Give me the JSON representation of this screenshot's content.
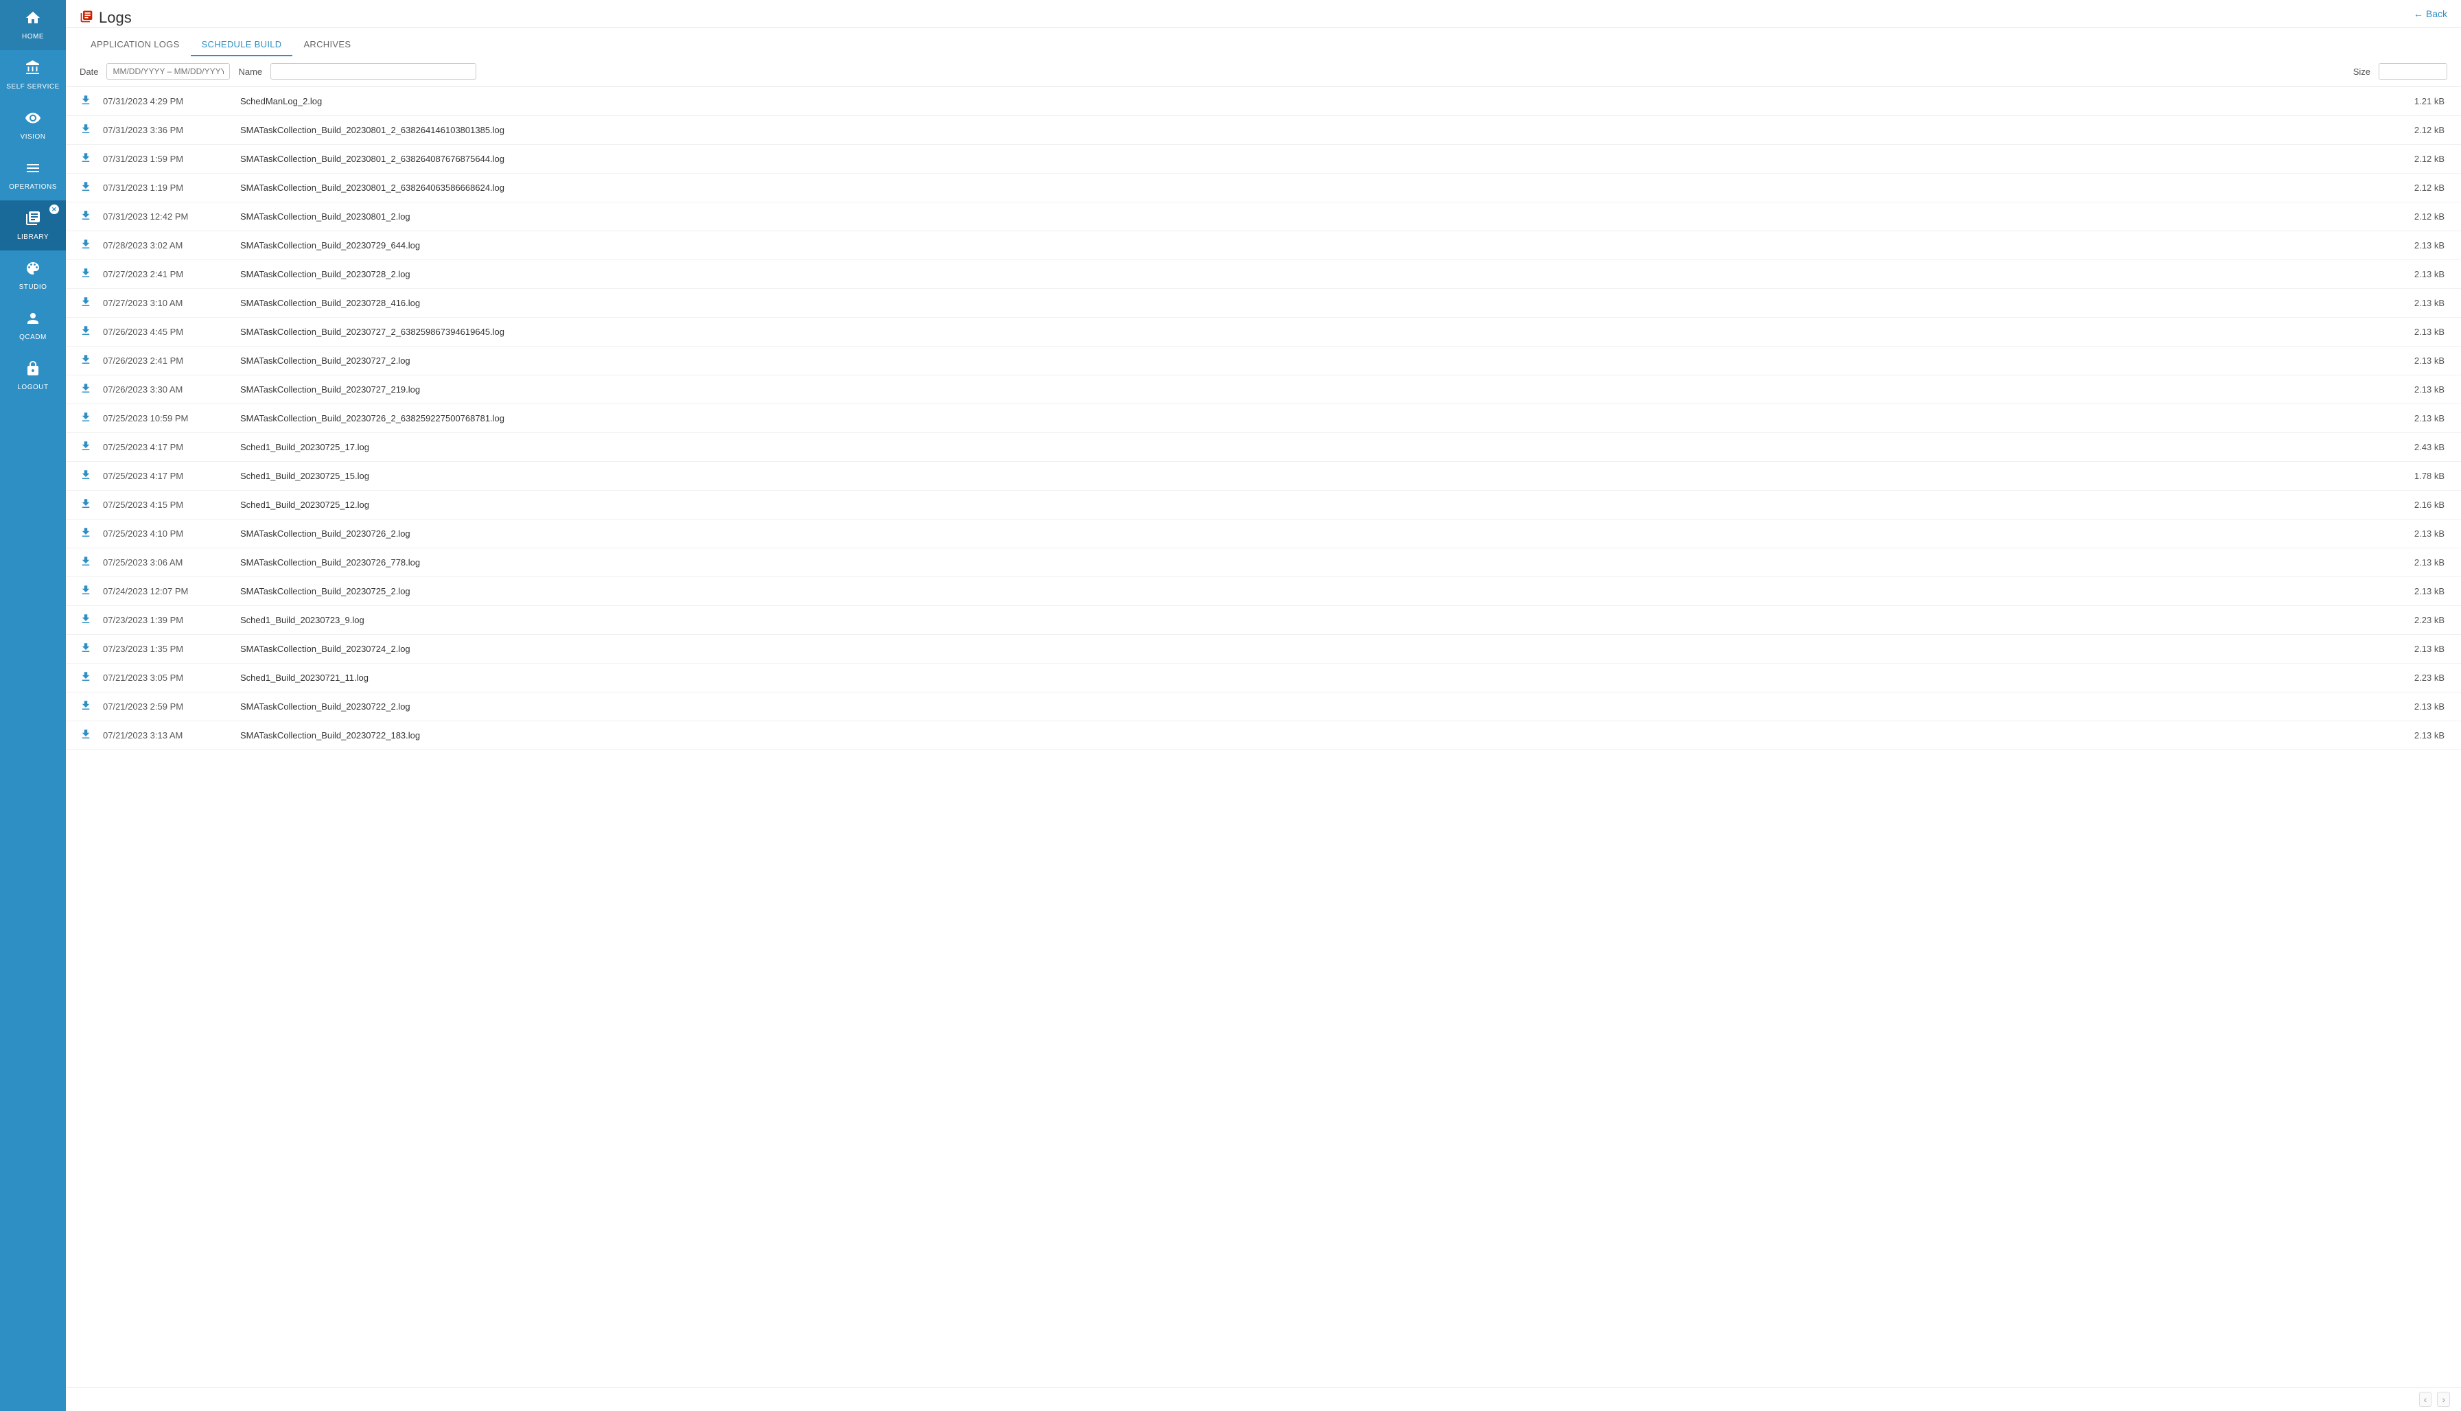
{
  "app": {
    "title": "Logs",
    "back_label": "Back"
  },
  "sidebar": {
    "items": [
      {
        "id": "home",
        "label": "HOME",
        "icon": "⌂",
        "active": false
      },
      {
        "id": "self-service",
        "label": "SELF SERVICE",
        "icon": "⇄",
        "active": false
      },
      {
        "id": "vision",
        "label": "VISION",
        "icon": "👁",
        "active": false
      },
      {
        "id": "operations",
        "label": "OPERATIONS",
        "icon": "≡",
        "active": false
      },
      {
        "id": "library",
        "label": "LIBRARY",
        "icon": "📚",
        "active": true
      },
      {
        "id": "studio",
        "label": "STUDIO",
        "icon": "🎨",
        "active": false
      },
      {
        "id": "qcadm",
        "label": "QCADM",
        "icon": "👤",
        "active": false
      },
      {
        "id": "logout",
        "label": "LOGOUT",
        "icon": "🔒",
        "active": false
      }
    ]
  },
  "tabs": [
    {
      "id": "application-logs",
      "label": "APPLICATION LOGS",
      "active": false
    },
    {
      "id": "schedule-build",
      "label": "SCHEDULE BUILD",
      "active": true
    },
    {
      "id": "archives",
      "label": "ARCHIVES",
      "active": false
    }
  ],
  "filters": {
    "date_placeholder": "MM/DD/YYYY – MM/DD/YYYY",
    "date_label": "Date",
    "name_label": "Name",
    "size_label": "Size",
    "date_value": "",
    "name_value": "",
    "size_value": ""
  },
  "logs": [
    {
      "date": "07/31/2023 4:29 PM",
      "name": "SchedManLog_2.log",
      "size": "1.21 kB"
    },
    {
      "date": "07/31/2023 3:36 PM",
      "name": "SMATaskCollection_Build_20230801_2_638264146103801385.log",
      "size": "2.12 kB"
    },
    {
      "date": "07/31/2023 1:59 PM",
      "name": "SMATaskCollection_Build_20230801_2_638264087676875644.log",
      "size": "2.12 kB"
    },
    {
      "date": "07/31/2023 1:19 PM",
      "name": "SMATaskCollection_Build_20230801_2_638264063586668624.log",
      "size": "2.12 kB"
    },
    {
      "date": "07/31/2023 12:42 PM",
      "name": "SMATaskCollection_Build_20230801_2.log",
      "size": "2.12 kB"
    },
    {
      "date": "07/28/2023 3:02 AM",
      "name": "SMATaskCollection_Build_20230729_644.log",
      "size": "2.13 kB"
    },
    {
      "date": "07/27/2023 2:41 PM",
      "name": "SMATaskCollection_Build_20230728_2.log",
      "size": "2.13 kB"
    },
    {
      "date": "07/27/2023 3:10 AM",
      "name": "SMATaskCollection_Build_20230728_416.log",
      "size": "2.13 kB"
    },
    {
      "date": "07/26/2023 4:45 PM",
      "name": "SMATaskCollection_Build_20230727_2_638259867394619645.log",
      "size": "2.13 kB"
    },
    {
      "date": "07/26/2023 2:41 PM",
      "name": "SMATaskCollection_Build_20230727_2.log",
      "size": "2.13 kB"
    },
    {
      "date": "07/26/2023 3:30 AM",
      "name": "SMATaskCollection_Build_20230727_219.log",
      "size": "2.13 kB"
    },
    {
      "date": "07/25/2023 10:59 PM",
      "name": "SMATaskCollection_Build_20230726_2_638259227500768781.log",
      "size": "2.13 kB"
    },
    {
      "date": "07/25/2023 4:17 PM",
      "name": "Sched1_Build_20230725_17.log",
      "size": "2.43 kB"
    },
    {
      "date": "07/25/2023 4:17 PM",
      "name": "Sched1_Build_20230725_15.log",
      "size": "1.78 kB"
    },
    {
      "date": "07/25/2023 4:15 PM",
      "name": "Sched1_Build_20230725_12.log",
      "size": "2.16 kB"
    },
    {
      "date": "07/25/2023 4:10 PM",
      "name": "SMATaskCollection_Build_20230726_2.log",
      "size": "2.13 kB"
    },
    {
      "date": "07/25/2023 3:06 AM",
      "name": "SMATaskCollection_Build_20230726_778.log",
      "size": "2.13 kB"
    },
    {
      "date": "07/24/2023 12:07 PM",
      "name": "SMATaskCollection_Build_20230725_2.log",
      "size": "2.13 kB"
    },
    {
      "date": "07/23/2023 1:39 PM",
      "name": "Sched1_Build_20230723_9.log",
      "size": "2.23 kB"
    },
    {
      "date": "07/23/2023 1:35 PM",
      "name": "SMATaskCollection_Build_20230724_2.log",
      "size": "2.13 kB"
    },
    {
      "date": "07/21/2023 3:05 PM",
      "name": "Sched1_Build_20230721_11.log",
      "size": "2.23 kB"
    },
    {
      "date": "07/21/2023 2:59 PM",
      "name": "SMATaskCollection_Build_20230722_2.log",
      "size": "2.13 kB"
    },
    {
      "date": "07/21/2023 3:13 AM",
      "name": "SMATaskCollection_Build_20230722_183.log",
      "size": "2.13 kB"
    }
  ]
}
